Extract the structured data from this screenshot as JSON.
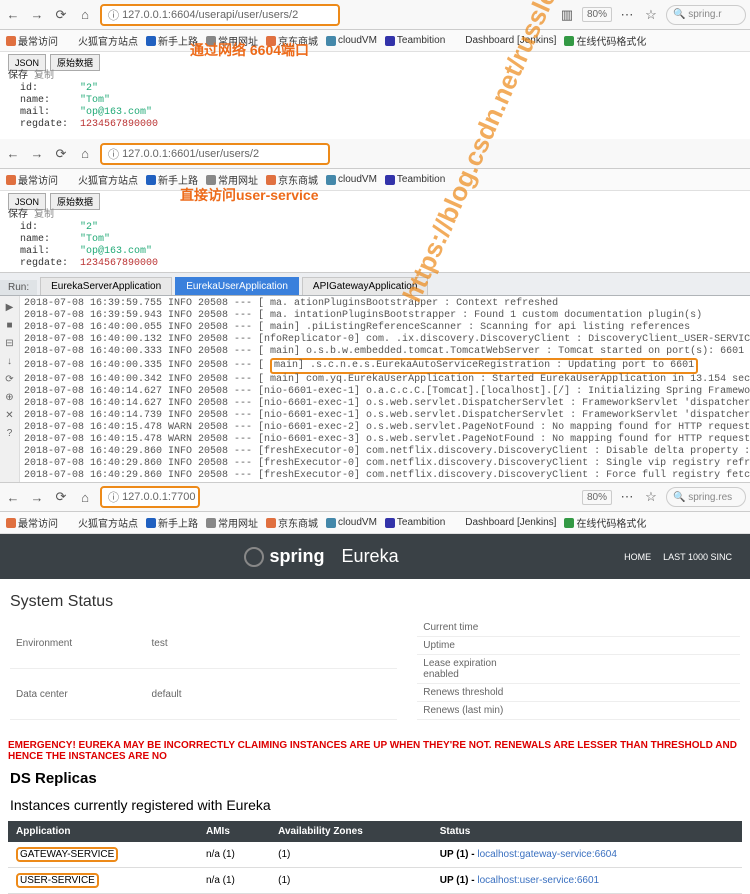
{
  "watermark": "https://blog.csdn.net/russle",
  "browser1": {
    "url_prefix": "127.0.0.1:",
    "url_port": "6604",
    "url_path": "/userapi/user/users/2",
    "zoom": "80%",
    "search": "spring.r",
    "ann": "通过网络 6604端口",
    "json": {
      "id": "\"2\"",
      "name": "\"Tom\"",
      "mail": "\"op@163.com\"",
      "regdate": "1234567890000"
    }
  },
  "browser2": {
    "url_prefix": "127.0.0.1:",
    "url_port": "6601",
    "url_path": "/user/users/2",
    "ann": "直接访问user-service",
    "json": {
      "id": "\"2\"",
      "name": "\"Tom\"",
      "mail": "\"op@163.com\"",
      "regdate": "1234567890000"
    }
  },
  "bookmarks": [
    "最常访问",
    "火狐官方站点",
    "新手上路",
    "常用网址",
    "京东商城",
    "cloudVM",
    "Teambition",
    "Dashboard [Jenkins]",
    "在线代码格式化"
  ],
  "run": {
    "label": "Run:",
    "tabs": [
      "EurekaServerApplication",
      "EurekaUserApplication",
      "APIGatewayApplication"
    ],
    "hlstart": "main]",
    "hlmid": ".s.c.n.e.s.EurekaAutoServiceRegistration",
    "hlend": ": Updating port to 6601",
    "lines": [
      "2018-07-08 16:39:59.755  INFO 20508 --- [           ma.               ationPluginsBootstrapper : Context refreshed",
      "2018-07-08 16:39:59.943  INFO 20508 --- [           ma.                 intationPluginsBootstrapper  : Found 1 custom documentation plugin(s)",
      "2018-07-08 16:40:00.055  INFO 20508 --- [         main]                 .piListingReferenceScanner   : Scanning for api listing references",
      "2018-07-08 16:40:00.132  INFO 20508 --- [nfoReplicator-0] com.     .ix.discovery.DiscoveryClient   : DiscoveryClient_USER-SERVICE/localhost:user-service:660",
      "2018-07-08 16:40:00.333  INFO 20508 --- [           main] o.s.b.w.embedded.tomcat.TomcatWebServer  : Tomcat started on port(s): 6601 (http) with context pat",
      "2018-07-08 16:40:00.335  INFO 20508 --- [           {HL}",
      "2018-07-08 16:40:00.342  INFO 20508 --- [           main] com.yq.EurekaUserApplication            : Started EurekaUserApplication in 13.154 seconds (JVM ru",
      "2018-07-08 16:40:14.627  INFO 20508 --- [nio-6601-exec-1] o.a.c.c.C.[Tomcat].[localhost].[/]       : Initializing Spring FrameworkServlet 'dispatcherServlet",
      "2018-07-08 16:40:14.627  INFO 20508 --- [nio-6601-exec-1] o.s.web.servlet.DispatcherServlet        : FrameworkServlet 'dispatcherServlet': initialization st",
      "2018-07-08 16:40:14.739  INFO 20508 --- [nio-6601-exec-1] o.s.web.servlet.DispatcherServlet        : FrameworkServlet 'dispatcherServlet': initialization co",
      "2018-07-08 16:40:15.478  WARN 20508 --- [nio-6601-exec-2] o.s.web.servlet.PageNotFound             : No mapping found for HTTP request with URI [/favicon.ic",
      "2018-07-08 16:40:15.478  WARN 20508 --- [nio-6601-exec-3] o.s.web.servlet.PageNotFound             : No mapping found for HTTP request with URI [/favicon.ic",
      "2018-07-08 16:40:29.860  INFO 20508 --- [freshExecutor-0] com.netflix.discovery.DiscoveryClient    : Disable delta property : false",
      "2018-07-08 16:40:29.860  INFO 20508 --- [freshExecutor-0] com.netflix.discovery.DiscoveryClient    : Single vip registry refresh property : null",
      "2018-07-08 16:40:29.860  INFO 20508 --- [freshExecutor-0] com.netflix.discovery.DiscoveryClient    : Force full registry fetch : false"
    ]
  },
  "browser3": {
    "url": "127.0.0.1:7700",
    "zoom": "80%",
    "search": "spring.res"
  },
  "eureka": {
    "brand_a": "spring",
    "brand_b": "Eureka",
    "menu": [
      "HOME",
      "LAST 1000 SINC"
    ],
    "sys_title": "System Status",
    "sys_left": [
      [
        "Environment",
        "test"
      ],
      [
        "Data center",
        "default"
      ]
    ],
    "sys_right": [
      "Current time",
      "Uptime",
      "Lease expiration enabled",
      "Renews threshold",
      "Renews (last min)"
    ],
    "warn": "EMERGENCY! EUREKA MAY BE INCORRECTLY CLAIMING INSTANCES ARE UP WHEN THEY'RE NOT. RENEWALS ARE LESSER THAN THRESHOLD AND HENCE THE INSTANCES ARE NO",
    "ds": "DS Replicas",
    "inst": "Instances currently registered with Eureka",
    "th": [
      "Application",
      "AMIs",
      "Availability Zones",
      "Status"
    ],
    "rows": [
      {
        "app": "GATEWAY-SERVICE",
        "amis": "n/a (1)",
        "az": "(1)",
        "up": "UP (1) - ",
        "lnk": "localhost:gateway-service:6604"
      },
      {
        "app": "USER-SERVICE",
        "amis": "n/a (1)",
        "az": "(1)",
        "up": "UP (1) - ",
        "lnk": "localhost:user-service:6601"
      }
    ]
  }
}
